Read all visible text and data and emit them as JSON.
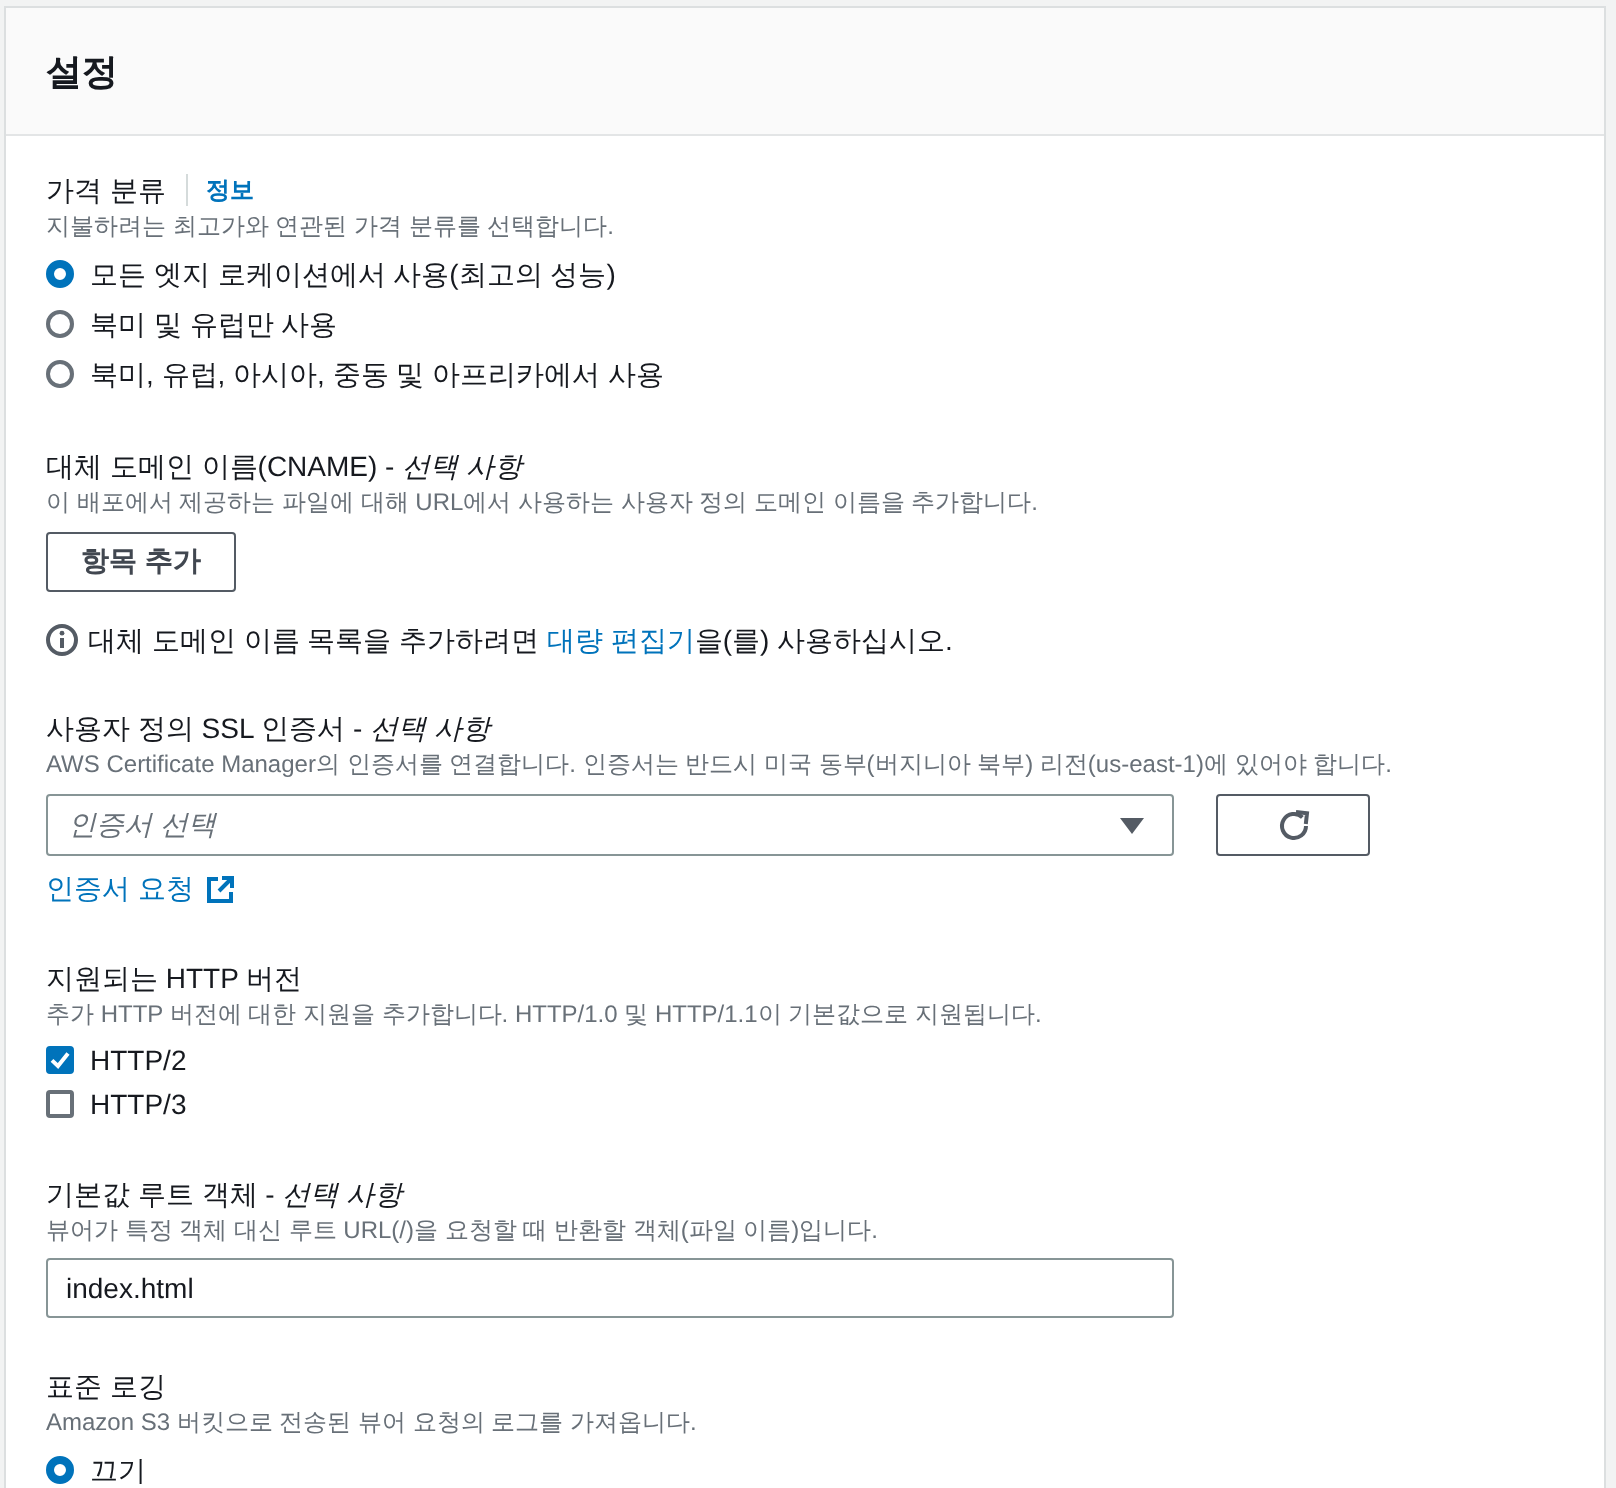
{
  "panel": {
    "title": "설정"
  },
  "sections": [
    {
      "kind": "radio-group",
      "label": "가격 분류",
      "info_link": "정보",
      "description": "지불하려는 최고가와 연관된 가격 분류를 선택합니다.",
      "options": [
        {
          "label": "모든 엣지 로케이션에서 사용(최고의 성능)",
          "selected": true
        },
        {
          "label": "북미 및 유럽만 사용",
          "selected": false
        },
        {
          "label": "북미, 유럽, 아시아, 중동 및 아프리카에서 사용",
          "selected": false
        }
      ]
    },
    {
      "kind": "list-editor",
      "label": "대체 도메인 이름(CNAME) - *선택 사항*",
      "description": "이 배포에서 제공하는 파일에 대해 URL에서 사용하는 사용자 정의 도메인 이름을 추가합니다.",
      "button": "항목 추가",
      "note": {
        "before": "대체 도메인 이름 목록을 추가하려면 ",
        "link": "대량 편집기",
        "after": "을(를) 사용하십시오."
      }
    },
    {
      "kind": "select",
      "label": "사용자 정의 SSL 인증서 - *선택 사항*",
      "description": "AWS Certificate Manager의 인증서를 연결합니다. 인증서는 반드시 미국 동부(버지니아 북부) 리전(us-east-1)에 있어야 합니다.",
      "placeholder": "인증서 선택",
      "link": "인증서 요청"
    },
    {
      "kind": "checkbox-group",
      "label": "지원되는 HTTP 버전",
      "description": "추가 HTTP 버전에 대한 지원을 추가합니다. HTTP/1.0 및 HTTP/1.1이 기본값으로 지원됩니다.",
      "options": [
        {
          "label": "HTTP/2",
          "checked": true
        },
        {
          "label": "HTTP/3",
          "checked": false
        }
      ]
    },
    {
      "kind": "text-input",
      "label": "기본값 루트 객체 - *선택 사항*",
      "description": "뷰어가 특정 객체 대신 루트 URL(/)을 요청할 때 반환할 객체(파일 이름)입니다.",
      "value": "index.html"
    },
    {
      "kind": "radio-group",
      "label": "표준 로깅",
      "description": "Amazon S3 버킷으로 전송된 뷰어 요청의 로그를 가져옵니다.",
      "options": [
        {
          "label": "끄기",
          "selected": true
        }
      ]
    }
  ]
}
